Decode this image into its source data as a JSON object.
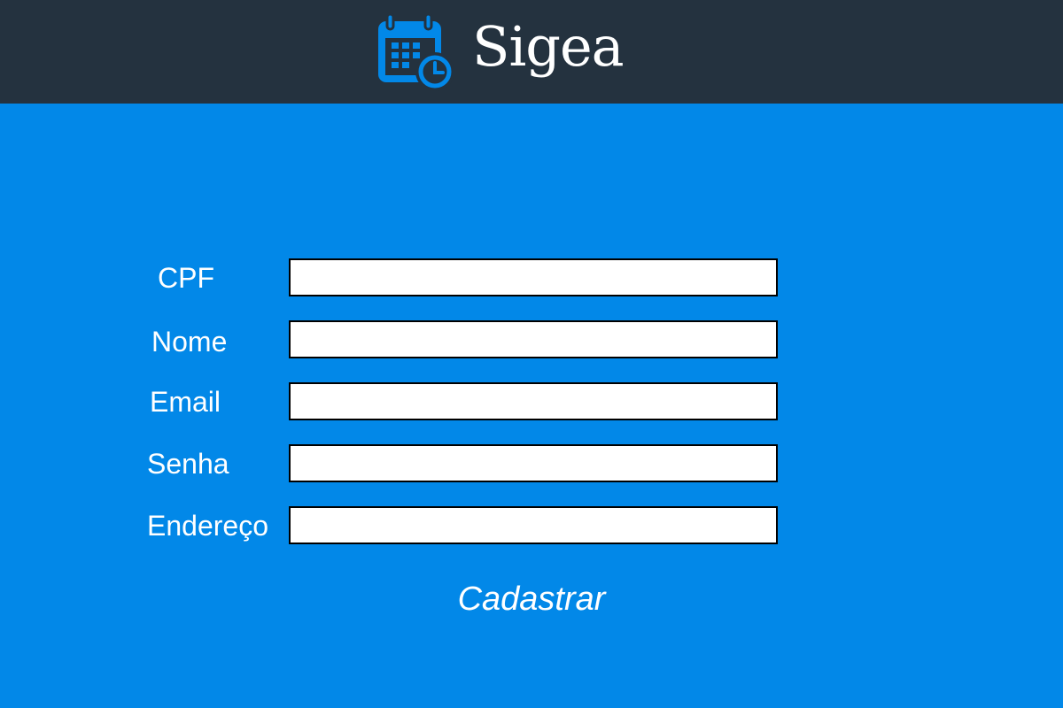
{
  "header": {
    "brand": "Sigea",
    "logo_icon": "calendar-clock-icon",
    "background_color": "#24323f",
    "icon_color": "#0288e8"
  },
  "form": {
    "background_color": "#0288e8",
    "fields": [
      {
        "label": "CPF",
        "value": "",
        "placeholder": ""
      },
      {
        "label": "Nome",
        "value": "",
        "placeholder": ""
      },
      {
        "label": "Email",
        "value": "",
        "placeholder": ""
      },
      {
        "label": "Senha",
        "value": "",
        "placeholder": ""
      },
      {
        "label": "Endereço",
        "value": "",
        "placeholder": ""
      }
    ],
    "submit_label": "Cadastrar"
  }
}
